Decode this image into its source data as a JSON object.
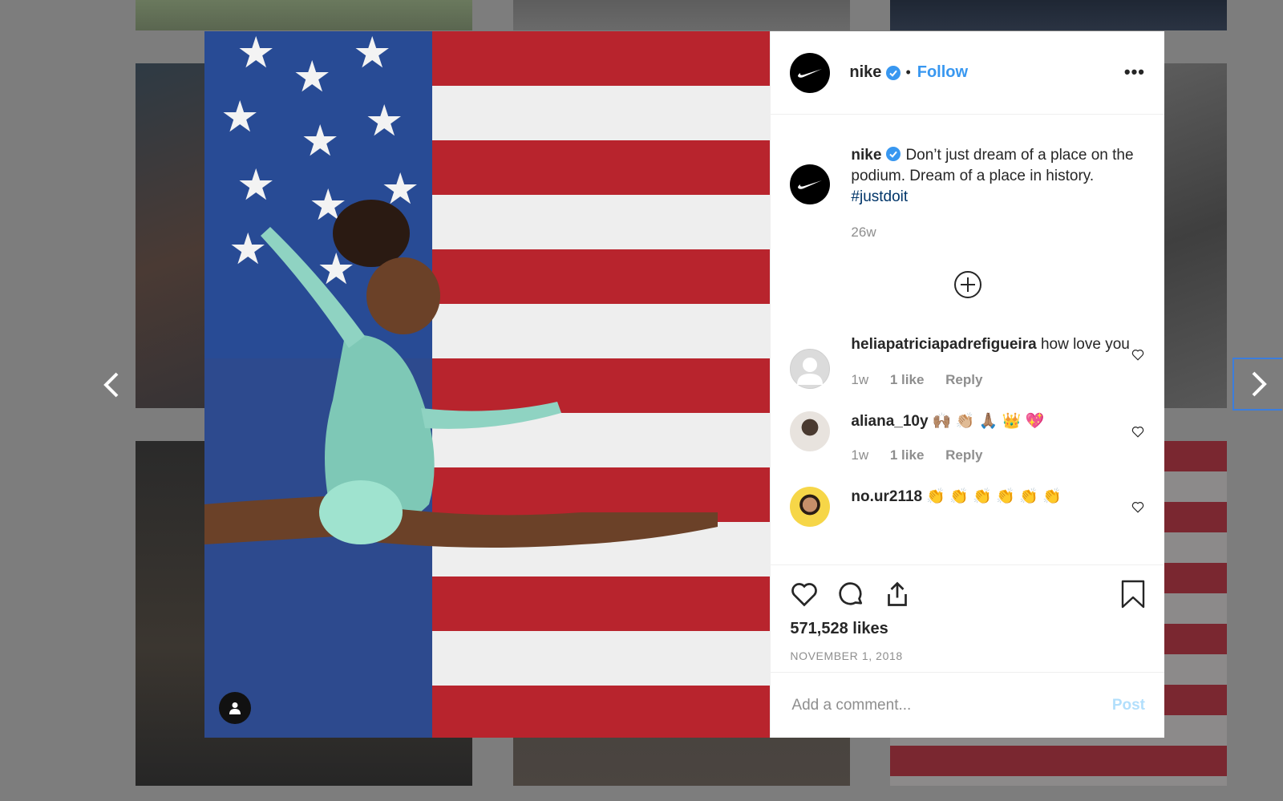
{
  "post": {
    "username": "nike",
    "follow_label": "Follow",
    "dot": "•",
    "more_label": "•••",
    "caption": "Don’t just dream of a place on the podium. Dream of a place in history.",
    "hashtag": "#justdoit",
    "caption_age": "26w",
    "likes": "571,528 likes",
    "date": "NOVEMBER 1, 2018"
  },
  "comments": [
    {
      "username": "heliapatriciapadrefigueira",
      "text": "how love you",
      "age": "1w",
      "likes": "1 like",
      "reply_label": "Reply"
    },
    {
      "username": "aliana_10y",
      "text": "🙌🏽 👏🏼 🙏🏽 👑 💖",
      "age": "1w",
      "likes": "1 like",
      "reply_label": "Reply"
    },
    {
      "username": "no.ur2118",
      "text": "👏 👏 👏 👏 👏 👏",
      "age": "",
      "likes": "",
      "reply_label": ""
    }
  ],
  "comment_box": {
    "placeholder": "Add a comment...",
    "post_label": "Post"
  },
  "icons": {
    "prev": "chevron-left-icon",
    "next": "chevron-right-icon",
    "like": "heart-icon",
    "comment": "comment-bubble-icon",
    "share": "share-icon",
    "save": "bookmark-icon",
    "load_more": "plus-circle-icon",
    "user_tag": "user-tag-icon",
    "verified": "verified-badge-icon"
  },
  "colors": {
    "link_blue": "#3897f0",
    "hashtag": "#003569",
    "muted": "#8e8e8e",
    "post_disabled": "#b2dffc"
  }
}
